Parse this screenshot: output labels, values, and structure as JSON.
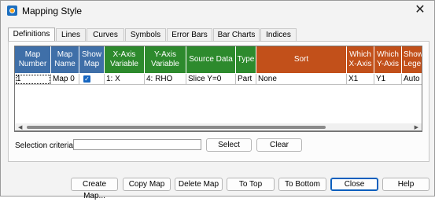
{
  "window": {
    "title": "Mapping Style",
    "close_glyph": "✕"
  },
  "tabs": [
    "Definitions",
    "Lines",
    "Curves",
    "Symbols",
    "Error Bars",
    "Bar Charts",
    "Indices"
  ],
  "grid": {
    "headers": [
      "Map\nNumber",
      "Map\nName",
      "Show\nMap",
      "X-Axis\nVariable",
      "Y-Axis\nVariable",
      "Source Data",
      "Type",
      "Sort",
      "Which\nX-Axis",
      "Which\nY-Axis",
      "Show\nLege"
    ],
    "header_colors": {
      "blue": "#3f6fa8",
      "green": "#2d8a2d",
      "orange": "#c2501a"
    },
    "rows": [
      {
        "map_number": "1",
        "map_name": "Map 0",
        "show_map": true,
        "x_var": "1: X",
        "y_var": "4: RHO",
        "source": "Slice Y=0",
        "type": "Part",
        "sort": "None",
        "which_x": "X1",
        "which_y": "Y1",
        "legend": "Auto"
      }
    ]
  },
  "criteria": {
    "label": "Selection criteria:",
    "value": "",
    "select": "Select",
    "clear": "Clear"
  },
  "buttons": {
    "create": "Create Map...",
    "copy": "Copy Map",
    "delete": "Delete Map",
    "top": "To Top",
    "bottom": "To Bottom",
    "close": "Close",
    "help": "Help"
  }
}
